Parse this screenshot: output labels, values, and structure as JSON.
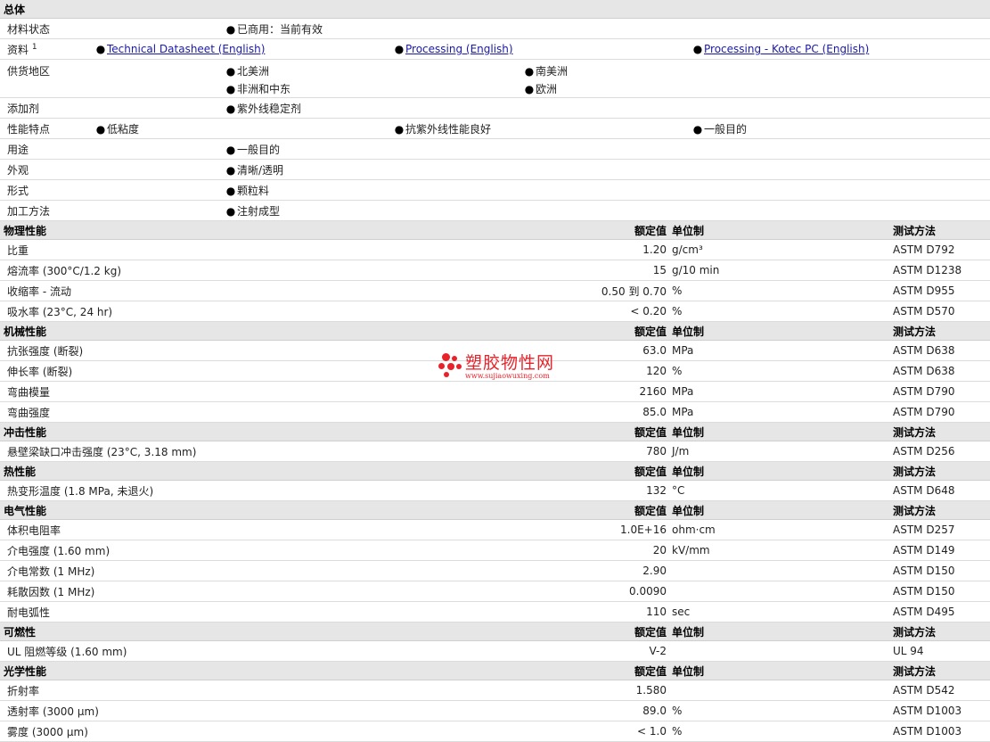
{
  "general": {
    "title": "总体",
    "rows": [
      {
        "label": "材料状态",
        "sup": "",
        "lines": [
          [
            "已商用：当前有效"
          ]
        ]
      },
      {
        "label": "资料",
        "sup": "1",
        "links": true,
        "lines": [
          [
            "Technical Datasheet (English)",
            "Processing (English)",
            "Processing - Kotec PC (English)"
          ]
        ]
      },
      {
        "label": "供货地区",
        "sup": "",
        "lines": [
          [
            "北美洲",
            "南美洲"
          ],
          [
            "非洲和中东",
            "欧洲"
          ]
        ]
      },
      {
        "label": "添加剂",
        "sup": "",
        "lines": [
          [
            "紫外线稳定剂"
          ]
        ]
      },
      {
        "label": "性能特点",
        "sup": "",
        "lines": [
          [
            "低粘度",
            "抗紫外线性能良好",
            "一般目的"
          ]
        ]
      },
      {
        "label": "用途",
        "sup": "",
        "lines": [
          [
            "一般目的"
          ]
        ]
      },
      {
        "label": "外观",
        "sup": "",
        "lines": [
          [
            "清晰/透明"
          ]
        ]
      },
      {
        "label": "形式",
        "sup": "",
        "lines": [
          [
            "颗粒料"
          ]
        ]
      },
      {
        "label": "加工方法",
        "sup": "",
        "lines": [
          [
            "注射成型"
          ]
        ]
      }
    ]
  },
  "columns": {
    "value": "额定值",
    "unit": "单位制",
    "method": "测试方法"
  },
  "sections": [
    {
      "title": "物理性能",
      "rows": [
        {
          "name": "比重",
          "cond": "",
          "value": "1.20",
          "unit": "g/cm³",
          "method": "ASTM D792"
        },
        {
          "name": "熔流率",
          "cond": "(300°C/1.2 kg)",
          "value": "15",
          "unit": "g/10 min",
          "method": "ASTM D1238"
        },
        {
          "name": "收缩率",
          "cond": "- 流动",
          "value": "0.50 到  0.70",
          "unit": "%",
          "method": "ASTM D955"
        },
        {
          "name": "吸水率",
          "cond": "(23°C, 24 hr)",
          "value": "< 0.20",
          "unit": "%",
          "method": "ASTM D570"
        }
      ]
    },
    {
      "title": "机械性能",
      "rows": [
        {
          "name": "抗张强度",
          "cond": "(断裂)",
          "value": "63.0",
          "unit": "MPa",
          "method": "ASTM D638"
        },
        {
          "name": "伸长率",
          "cond": "(断裂)",
          "value": "120",
          "unit": "%",
          "method": "ASTM D638"
        },
        {
          "name": "弯曲模量",
          "cond": "",
          "value": "2160",
          "unit": "MPa",
          "method": "ASTM D790"
        },
        {
          "name": "弯曲强度",
          "cond": "",
          "value": "85.0",
          "unit": "MPa",
          "method": "ASTM D790"
        }
      ]
    },
    {
      "title": "冲击性能",
      "rows": [
        {
          "name": "悬壁梁缺口冲击强度",
          "cond": "(23°C, 3.18 mm)",
          "value": "780",
          "unit": "J/m",
          "method": "ASTM D256"
        }
      ]
    },
    {
      "title": "热性能",
      "rows": [
        {
          "name": "热变形温度",
          "cond": "(1.8 MPa, 未退火)",
          "value": "132",
          "unit": "°C",
          "method": "ASTM D648"
        }
      ]
    },
    {
      "title": "电气性能",
      "rows": [
        {
          "name": "体积电阻率",
          "cond": "",
          "value": "1.0E+16",
          "unit": "ohm·cm",
          "method": "ASTM D257"
        },
        {
          "name": "介电强度",
          "cond": "(1.60 mm)",
          "value": "20",
          "unit": "kV/mm",
          "method": "ASTM D149"
        },
        {
          "name": "介电常数",
          "cond": "(1 MHz)",
          "value": "2.90",
          "unit": "",
          "method": "ASTM D150"
        },
        {
          "name": "耗散因数",
          "cond": "(1 MHz)",
          "value": "0.0090",
          "unit": "",
          "method": "ASTM D150"
        },
        {
          "name": "耐电弧性",
          "cond": "",
          "value": "110",
          "unit": "sec",
          "method": "ASTM D495"
        }
      ]
    },
    {
      "title": "可燃性",
      "rows": [
        {
          "name": "UL 阻燃等级",
          "cond": "(1.60 mm)",
          "value": "V-2",
          "unit": "",
          "method": "UL 94"
        }
      ]
    },
    {
      "title": "光学性能",
      "rows": [
        {
          "name": "折射率",
          "cond": "",
          "value": "1.580",
          "unit": "",
          "method": "ASTM D542"
        },
        {
          "name": "透射率",
          "cond": "(3000 µm)",
          "value": "89.0",
          "unit": "%",
          "method": "ASTM D1003"
        },
        {
          "name": "雾度",
          "cond": "(3000 µm)",
          "value": "< 1.0",
          "unit": "%",
          "method": "ASTM D1003"
        }
      ]
    }
  ],
  "watermark": {
    "text": "塑胶物性网",
    "url": "www.sujiaowuxing.com",
    "color": "#e8222a"
  }
}
